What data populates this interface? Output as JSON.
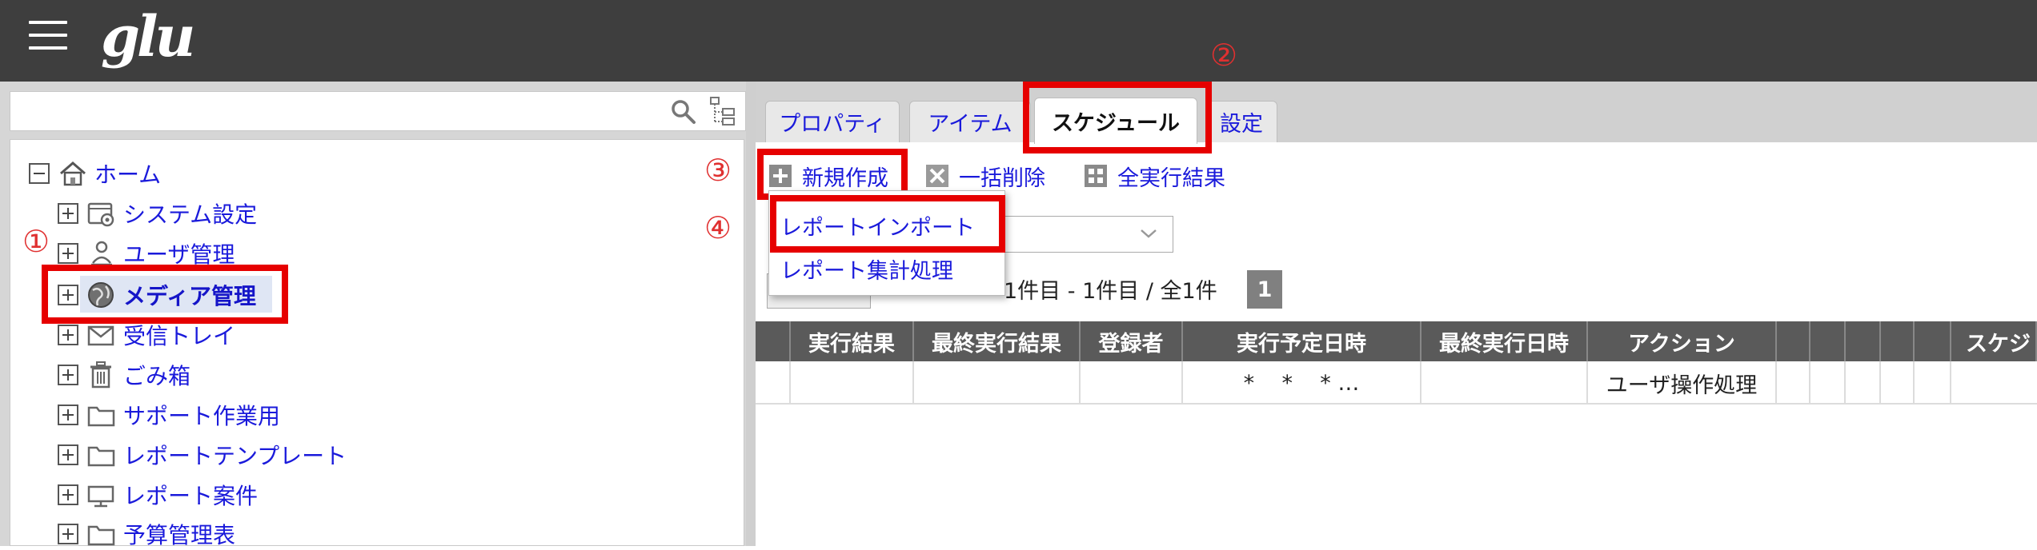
{
  "app": {
    "logo_text": "glu"
  },
  "markers": {
    "m1": "①",
    "m2": "②",
    "m3": "③",
    "m4": "④"
  },
  "tree": {
    "root": {
      "label": "ホーム",
      "icon": "home-icon"
    },
    "items": [
      {
        "label": "システム設定",
        "icon": "system-settings-icon"
      },
      {
        "label": "ユーザ管理",
        "icon": "users-icon"
      },
      {
        "label": "メディア管理",
        "icon": "globe-icon",
        "selected": true
      },
      {
        "label": "受信トレイ",
        "icon": "mail-icon"
      },
      {
        "label": "ごみ箱",
        "icon": "trash-icon"
      },
      {
        "label": "サポート作業用",
        "icon": "folder-icon"
      },
      {
        "label": "レポートテンプレート",
        "icon": "folder-icon"
      },
      {
        "label": "レポート案件",
        "icon": "folder-icon"
      },
      {
        "label": "予算管理表",
        "icon": "folder-icon"
      }
    ]
  },
  "tabs": [
    {
      "label": "プロパティ"
    },
    {
      "label": "アイテム"
    },
    {
      "label": "スケジュール",
      "active": true
    },
    {
      "label": "設定"
    }
  ],
  "toolbar": {
    "new_label": "新規作成",
    "bulk_delete_label": "一括削除",
    "all_results_label": "全実行結果"
  },
  "dropdown": {
    "items": [
      {
        "label": "レポートインポート"
      },
      {
        "label": "レポート集計処理"
      }
    ]
  },
  "pager": {
    "info": "1件目 - 1件目 / 全1件",
    "current_page": "1"
  },
  "grid": {
    "columns": [
      "実行結果",
      "最終実行結果",
      "登録者",
      "実行予定日時",
      "最終実行日時",
      "アクション",
      "スケジ"
    ],
    "rows": [
      {
        "schedule": "*    *    * …",
        "action": "ユーザ操作処理"
      }
    ]
  },
  "colors": {
    "accent_red": "#e60000",
    "link_blue": "#1a1adb",
    "header_bg": "#3e3e3e",
    "grid_header_bg": "#5a5a5a"
  }
}
